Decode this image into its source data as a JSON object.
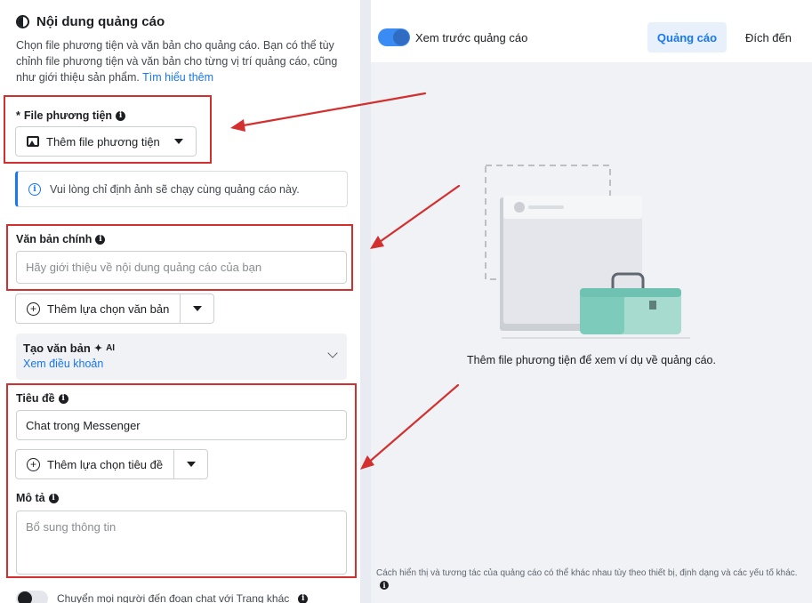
{
  "section": {
    "title": "Nội dung quảng cáo",
    "description": "Chọn file phương tiện và văn bản cho quảng cáo. Bạn có thể tùy chỉnh file phương tiện và văn bản cho từng vị trí quảng cáo, cũng như giới thiệu sản phẩm.",
    "learn_more": "Tìm hiểu thêm"
  },
  "media": {
    "required_mark": "*",
    "label": "File phương tiện",
    "add_button": "Thêm file phương tiện"
  },
  "notice": {
    "text": "Vui lòng chỉ định ảnh sẽ chạy cùng quảng cáo này."
  },
  "primary_text": {
    "label": "Văn bản chính",
    "placeholder": "Hãy giới thiệu về nội dung quảng cáo của bạn",
    "add_option_button": "Thêm lựa chọn văn bản"
  },
  "generate_text": {
    "title": "Tạo văn bản",
    "ai_badge": "AI",
    "terms_link": "Xem điều khoản"
  },
  "headline": {
    "label": "Tiêu đề",
    "value": "Chat trong Messenger",
    "add_option_button": "Thêm lựa chọn tiêu đề"
  },
  "description_field": {
    "label": "Mô tả",
    "placeholder": "Bổ sung thông tin"
  },
  "bottom_toggle": {
    "label": "Chuyển mọi người đến đoạn chat với Trang khác"
  },
  "preview": {
    "toggle_label": "Xem trước quảng cáo",
    "tabs": [
      "Quảng cáo",
      "Đích đến"
    ],
    "active_tab": "Quảng cáo",
    "empty_text": "Thêm file phương tiện để xem ví dụ về quảng cáo.",
    "footnote": "Cách hiển thị và tương tác của quảng cáo có thể khác nhau tùy theo thiết bị, định dạng và các yếu tố khác."
  },
  "colors": {
    "accent": "#1877f2",
    "annotation_red": "#d32f2f",
    "panel_bg": "#f0f2f5"
  },
  "icons": {
    "section": "half-circle-icon",
    "media": "image-icon",
    "info": "info-icon",
    "add": "plus-circle-icon",
    "dropdown": "caret-down-icon",
    "expand": "chevron-down-icon",
    "ai": "sparkle-icon"
  }
}
